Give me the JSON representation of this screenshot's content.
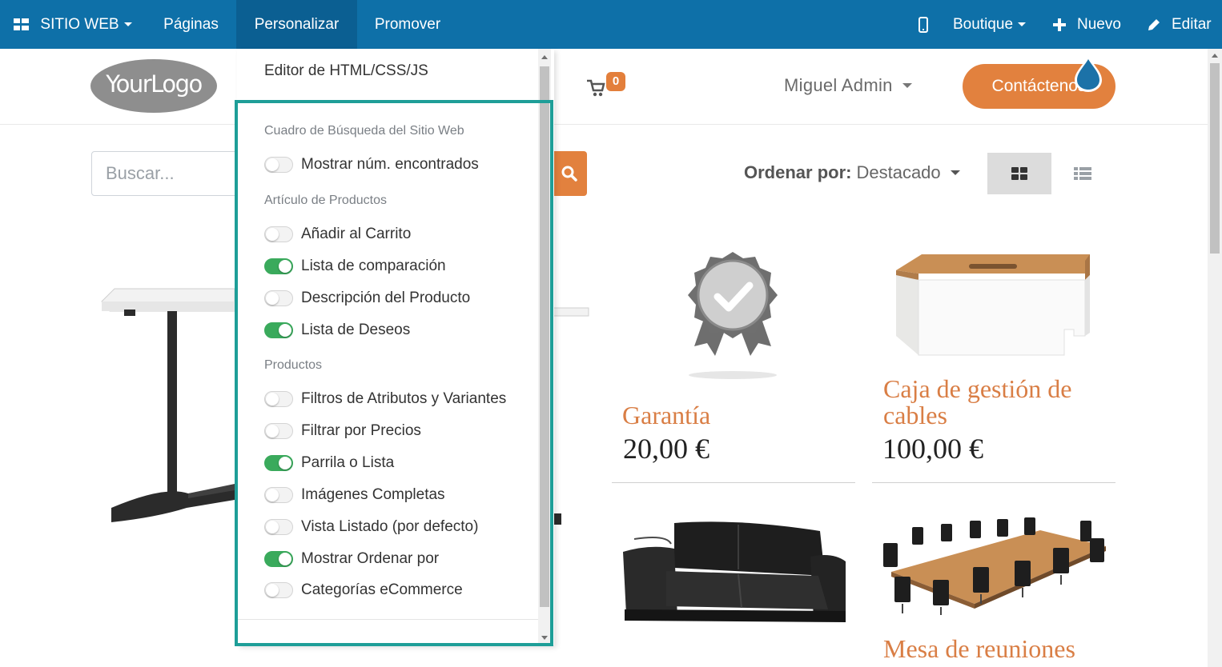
{
  "topbar": {
    "website_label": "SITIO WEB",
    "pages_label": "Páginas",
    "customize_label": "Personalizar",
    "promote_label": "Promover",
    "boutique_label": "Boutique",
    "new_label": "Nuevo",
    "edit_label": "Editar",
    "bg_color": "#0e70a8"
  },
  "header": {
    "logo_text": "YourLogo",
    "cart_count": "0",
    "user_name": "Miguel Admin",
    "contact_label": "Contáctenos"
  },
  "search": {
    "placeholder": "Buscar..."
  },
  "sort": {
    "label": "Ordenar por:",
    "value": "Destacado"
  },
  "products": [
    {
      "name": "Garantía",
      "price": "20,00 €"
    },
    {
      "name": "Caja de gestión de cables",
      "price": "100,00 €"
    },
    {
      "name": "Mesa de reuniones"
    }
  ],
  "dropdown": {
    "editor_label": "Editor de HTML/CSS/JS",
    "sections": [
      {
        "header": "Cuadro de Búsqueda del Sitio Web",
        "options": [
          {
            "label": "Mostrar núm. encontrados",
            "on": false
          }
        ]
      },
      {
        "header": "Artículo de Productos",
        "options": [
          {
            "label": "Añadir al Carrito",
            "on": false
          },
          {
            "label": "Lista de comparación",
            "on": true
          },
          {
            "label": "Descripción del Producto",
            "on": false
          },
          {
            "label": "Lista de Deseos",
            "on": true
          }
        ]
      },
      {
        "header": "Productos",
        "options": [
          {
            "label": "Filtros de Atributos y Variantes",
            "on": false
          },
          {
            "label": "Filtrar por Precios",
            "on": false
          },
          {
            "label": "Parrila o Lista",
            "on": true
          },
          {
            "label": "Imágenes Completas",
            "on": false
          },
          {
            "label": "Vista Listado (por defecto)",
            "on": false
          },
          {
            "label": "Mostrar Ordenar por",
            "on": true
          },
          {
            "label": "Categorías eCommerce",
            "on": false
          }
        ]
      }
    ]
  },
  "colors": {
    "accent_orange": "#e2813e",
    "toggle_on": "#3aaa5c",
    "highlight": "#1e9e98",
    "product_title": "#d97e45"
  }
}
